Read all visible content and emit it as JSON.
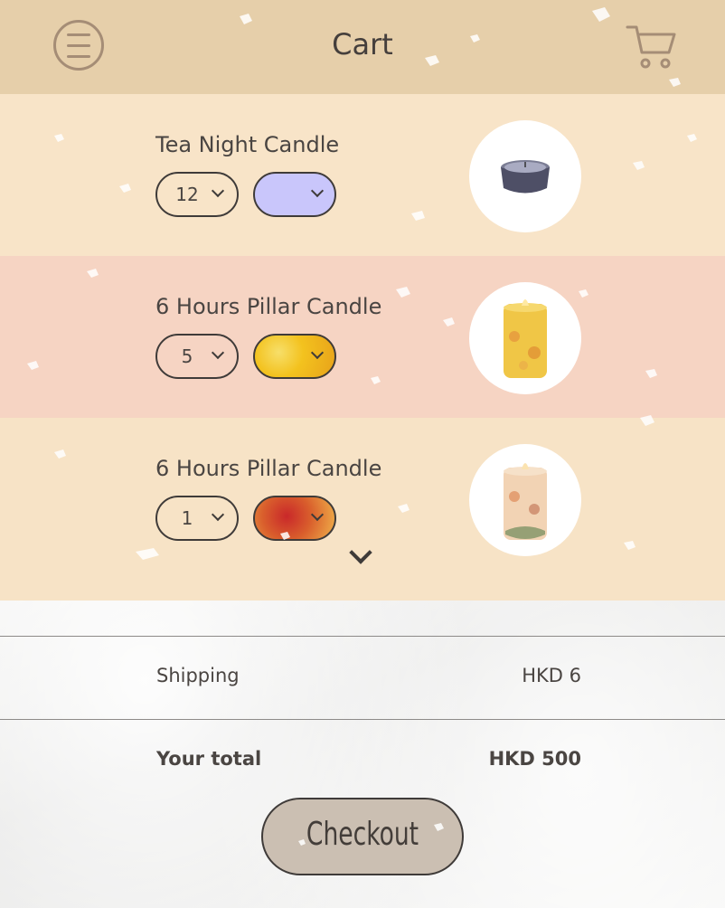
{
  "header": {
    "title": "Cart",
    "menu_icon": "menu-icon",
    "cart_icon": "cart-icon"
  },
  "items": [
    {
      "name": "Tea Night Candle",
      "quantity": "12",
      "color": "#c9c6fb",
      "photo_icon": "tealight-candle-photo"
    },
    {
      "name": "6 Hours Pillar Candle",
      "quantity": "5",
      "color": "#f3c21e",
      "photo_icon": "yellow-pillar-candle-photo"
    },
    {
      "name": "6 Hours Pillar Candle",
      "quantity": "1",
      "color": "#d95e2c",
      "photo_icon": "floral-pillar-candle-photo"
    }
  ],
  "summary": {
    "shipping_label": "Shipping",
    "shipping_value": "HKD 6",
    "total_label": "Your total",
    "total_value": "HKD 500"
  },
  "checkout_label": "Checkout",
  "colors": {
    "header_bg": "#e6cfaa",
    "row_1_bg": "#f8e4c8",
    "row_2_bg": "#f6d4c3",
    "row_3_bg": "#f7e3c6",
    "checkout_bg": "#cbbfb2"
  }
}
